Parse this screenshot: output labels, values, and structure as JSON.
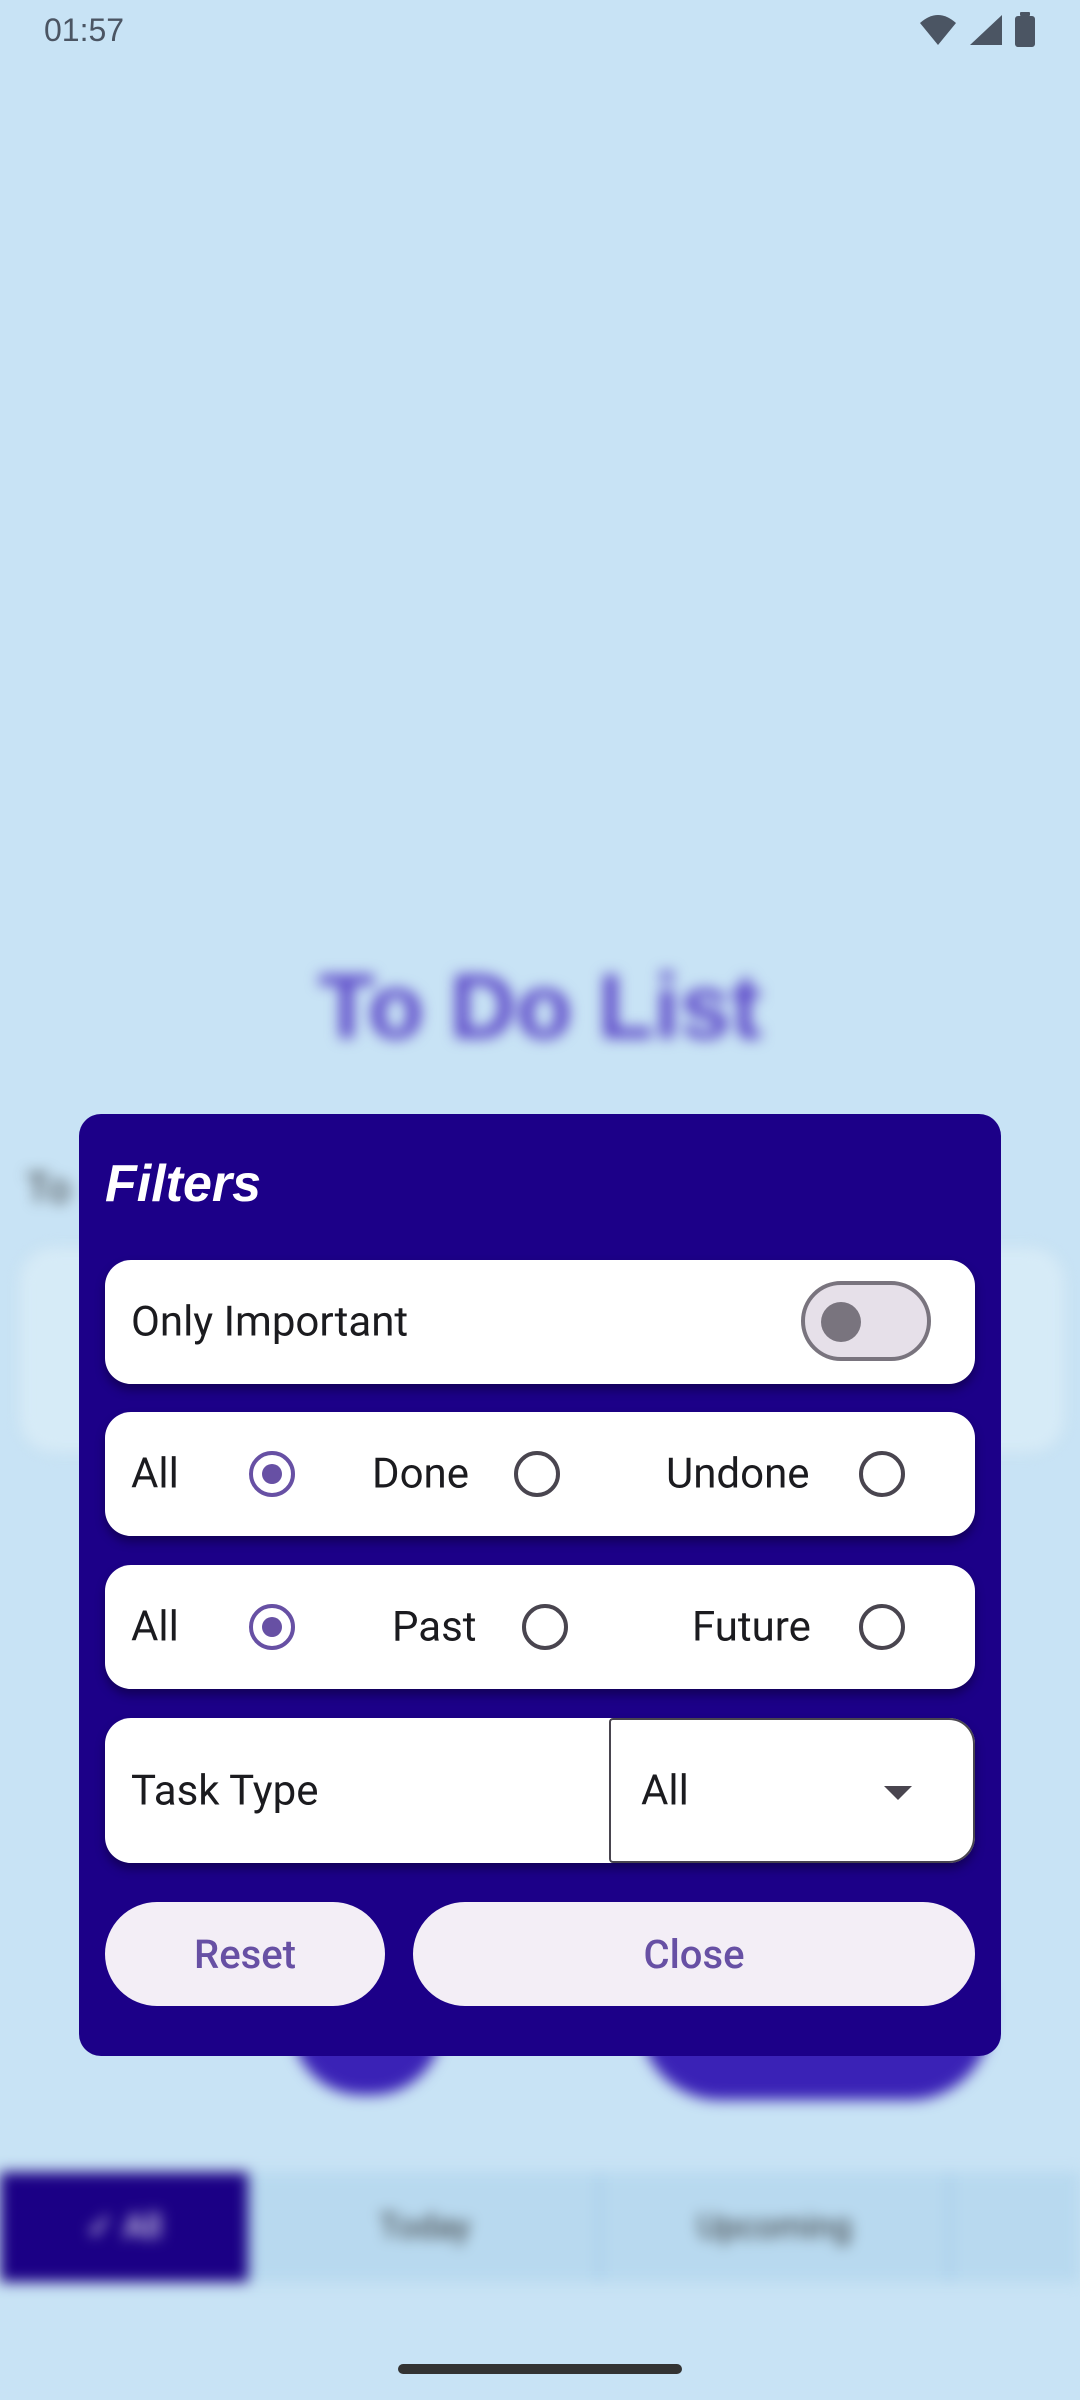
{
  "status_bar": {
    "time": "01:57",
    "icons": [
      "wifi-icon",
      "signal-icon",
      "battery-icon"
    ]
  },
  "background": {
    "title": "To Do List",
    "section_label": "To",
    "tabs": [
      {
        "label": "✓ All",
        "active": true
      },
      {
        "label": "Today",
        "active": false
      },
      {
        "label": "Upcoming",
        "active": false
      },
      {
        "label": "",
        "active": false
      }
    ]
  },
  "dialog": {
    "title": "Filters",
    "only_important": {
      "label": "Only Important",
      "checked": false
    },
    "status_filter": {
      "options": [
        {
          "label": "All",
          "selected": true
        },
        {
          "label": "Done",
          "selected": false
        },
        {
          "label": "Undone",
          "selected": false
        }
      ]
    },
    "date_filter": {
      "options": [
        {
          "label": "All",
          "selected": true
        },
        {
          "label": "Past",
          "selected": false
        },
        {
          "label": "Future",
          "selected": false
        }
      ]
    },
    "task_type": {
      "label": "Task Type",
      "value": "All"
    },
    "buttons": {
      "reset": "Reset",
      "close": "Close"
    }
  },
  "colors": {
    "dialog_bg": "#1c0088",
    "accent": "#6750a4",
    "page_bg": "#c8e3f5",
    "button_bg": "#f3eef6"
  }
}
